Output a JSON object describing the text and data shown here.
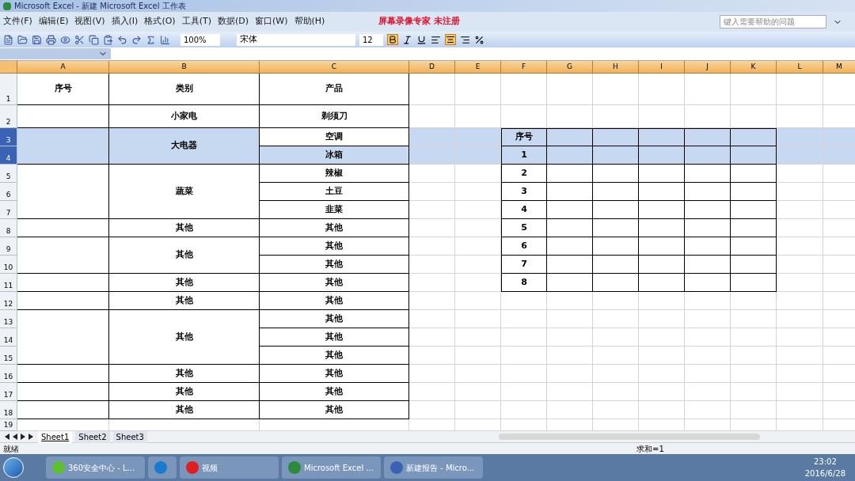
{
  "window": {
    "title": "Microsoft Excel - 新建 Microsoft Excel 工作表",
    "watermark_note": "屏幕录像专家 未注册"
  },
  "menu": [
    "文件(F)",
    "编辑(E)",
    "视图(V)",
    "插入(I)",
    "格式(O)",
    "工具(T)",
    "数据(D)",
    "窗口(W)",
    "帮助(H)"
  ],
  "help_search": {
    "placeholder": "键入需要帮助的问题"
  },
  "toolbar": {
    "zoom": "100%",
    "font": "宋体",
    "size": "12"
  },
  "columns": [
    "A",
    "B",
    "C",
    "D",
    "E",
    "F",
    "G",
    "H",
    "I",
    "J",
    "K",
    "L",
    "M"
  ],
  "row_headers": [
    "1",
    "2",
    "3",
    "4",
    "5",
    "6",
    "7",
    "8",
    "9",
    "10",
    "11",
    "12",
    "13",
    "14",
    "15",
    "16",
    "17",
    "18",
    "19"
  ],
  "left_table": [
    {
      "index": "序号",
      "category": "类别",
      "selected": false,
      "products": [
        {
          "text": "产品",
          "active": false
        }
      ]
    },
    {
      "category": "小家电",
      "selected": false,
      "products": [
        {
          "text": "剃须刀",
          "active": false
        }
      ]
    },
    {
      "category": "大电器",
      "selected": true,
      "products": [
        {
          "text": "空调",
          "active": true
        },
        {
          "text": "冰箱",
          "active": false
        }
      ]
    },
    {
      "category": "蔬菜",
      "selected": false,
      "products": [
        {
          "text": "辣椒",
          "active": false
        },
        {
          "text": "土豆",
          "active": false
        },
        {
          "text": "韭菜",
          "active": false
        }
      ]
    },
    {
      "category": "其他",
      "selected": false,
      "products": [
        {
          "text": "其他",
          "active": false
        }
      ]
    },
    {
      "category": "其他",
      "selected": false,
      "products": [
        {
          "text": "其他",
          "active": false
        },
        {
          "text": "其他",
          "active": false
        }
      ]
    },
    {
      "category": "其他",
      "selected": false,
      "products": [
        {
          "text": "其他",
          "active": false
        }
      ]
    },
    {
      "category": "其他",
      "selected": false,
      "products": [
        {
          "text": "其他",
          "active": false
        }
      ]
    },
    {
      "category": "其他",
      "selected": false,
      "products": [
        {
          "text": "其他",
          "active": false
        },
        {
          "text": "其他",
          "active": false
        },
        {
          "text": "其他",
          "active": false
        }
      ]
    },
    {
      "category": "其他",
      "selected": false,
      "products": [
        {
          "text": "其他",
          "active": false
        }
      ]
    },
    {
      "category": "其他",
      "selected": false,
      "products": [
        {
          "text": "其他",
          "active": false
        }
      ]
    },
    {
      "category": "其他",
      "selected": false,
      "products": [
        {
          "text": "其他",
          "active": false
        }
      ]
    }
  ],
  "right_table": {
    "header": "序号",
    "numbers": [
      "1",
      "2",
      "3",
      "4",
      "5",
      "6",
      "7",
      "8"
    ]
  },
  "sheet_tabs": [
    {
      "label": "Sheet1",
      "selected": true
    },
    {
      "label": "Sheet2",
      "selected": false
    },
    {
      "label": "Sheet3",
      "selected": false
    }
  ],
  "status_bar": {
    "left": "就绪",
    "sum": "求和=1"
  },
  "taskbar": {
    "items": [
      {
        "label": "360安全中心 - L...",
        "kind": "green"
      },
      {
        "kind": "k"
      },
      {
        "label": "视频",
        "kind": "play"
      },
      {
        "label": "Microsoft Excel ...",
        "kind": "excel"
      },
      {
        "label": "新建报告 - Micro...",
        "kind": "doc"
      }
    ],
    "time": "23:02",
    "date": "2016/6/28"
  }
}
